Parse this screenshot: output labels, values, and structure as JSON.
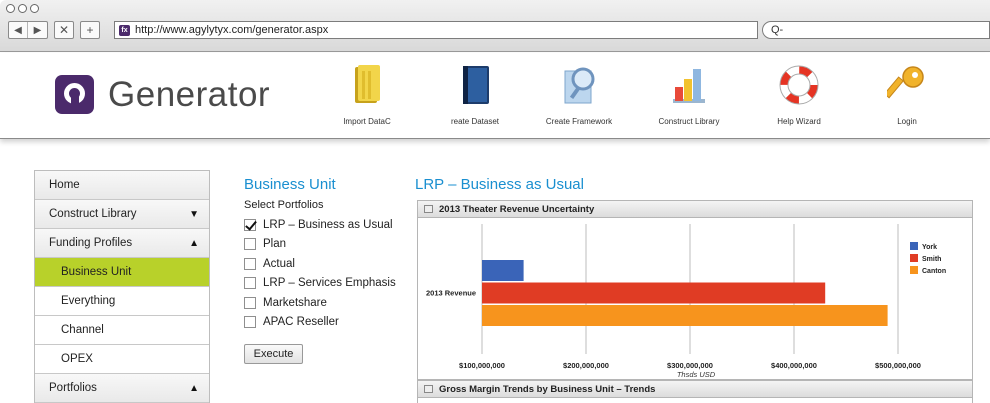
{
  "browser": {
    "url": "http://www.agylytyx.com/generator.aspx",
    "search_placeholder": "Q-",
    "favicon_text": "fx"
  },
  "header": {
    "app_name": "Generator",
    "tools": [
      {
        "label": "Import DataC",
        "icon": "folder-icon"
      },
      {
        "label": "reate Dataset",
        "icon": "book-icon"
      },
      {
        "label": "Create Framework",
        "icon": "magnifier-icon"
      },
      {
        "label": "Construct Library",
        "icon": "bar-chart-icon"
      },
      {
        "label": "Help Wizard",
        "icon": "lifebuoy-icon"
      },
      {
        "label": "Login",
        "icon": "key-icon"
      }
    ]
  },
  "sidebar": {
    "items": [
      {
        "label": "Home",
        "arrow": "",
        "sub": false,
        "active": false
      },
      {
        "label": "Construct Library",
        "arrow": "▼",
        "sub": false,
        "active": false
      },
      {
        "label": "Funding Profiles",
        "arrow": "▲",
        "sub": false,
        "active": false
      },
      {
        "label": "Business Unit",
        "arrow": "",
        "sub": true,
        "active": true
      },
      {
        "label": "Everything",
        "arrow": "",
        "sub": true,
        "active": false
      },
      {
        "label": "Channel",
        "arrow": "",
        "sub": true,
        "active": false
      },
      {
        "label": "OPEX",
        "arrow": "",
        "sub": true,
        "active": false
      },
      {
        "label": "Portfolios",
        "arrow": "▲",
        "sub": false,
        "active": false
      }
    ]
  },
  "business_unit": {
    "title": "Business Unit",
    "subtitle": "Select Portfolios",
    "options": [
      {
        "label": "LRP – Business as Usual",
        "checked": true
      },
      {
        "label": "Plan",
        "checked": false
      },
      {
        "label": "Actual",
        "checked": false
      },
      {
        "label": "LRP – Services Emphasis",
        "checked": false
      },
      {
        "label": "Marketshare",
        "checked": false
      },
      {
        "label": "APAC Reseller",
        "checked": false
      }
    ],
    "execute_label": "Execute"
  },
  "main": {
    "title": "LRP – Business as Usual",
    "second_panel_title": "Gross Margin Trends by Business Unit – Trends"
  },
  "chart_data": {
    "type": "bar",
    "orientation": "horizontal",
    "title": "2013 Theater Revenue Uncertainty",
    "categories": [
      "2013 Revenue"
    ],
    "series": [
      {
        "name": "York",
        "color": "#3a64b8",
        "values": [
          140000000
        ]
      },
      {
        "name": "Smith",
        "color": "#e03c24",
        "values": [
          430000000
        ]
      },
      {
        "name": "Canton",
        "color": "#f7941d",
        "values": [
          490000000
        ]
      }
    ],
    "xlim": [
      100000000,
      500000000
    ],
    "xticks": [
      "$100,000,000",
      "$200,000,000",
      "$300,000,000",
      "$400,000,000",
      "$500,000,000"
    ],
    "xlabel": "Thsds USD",
    "grid": true,
    "legend": "right"
  }
}
